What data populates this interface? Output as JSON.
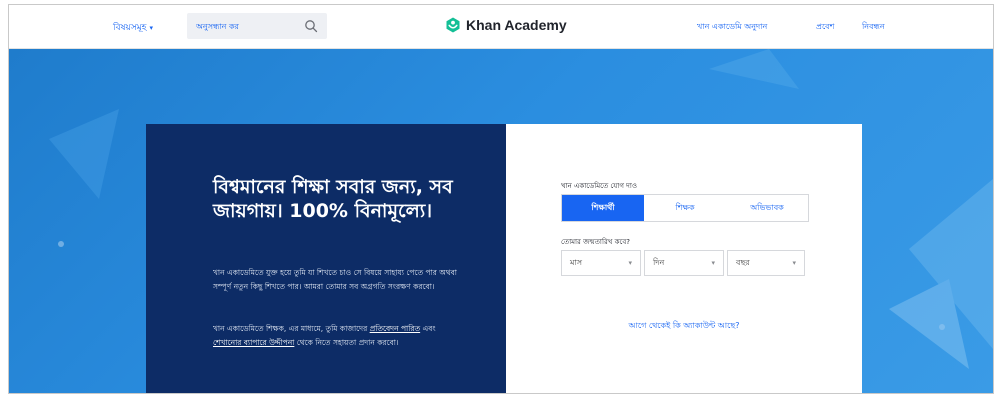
{
  "nav": {
    "subjects_label": "বিষয়সমূহ",
    "search_placeholder": "অনুসন্ধান কর",
    "brand_name": "Khan Academy",
    "donate_label": "খান একাডেমি অনুদান",
    "login_label": "প্রবেশ",
    "signup_label": "নিবন্ধন"
  },
  "hero": {
    "headline": "বিশ্বমানের শিক্ষা সবার জন্য, সব জায়গায়। 100% বিনামূল্যে।",
    "paragraph1": "খান একাডেমিতে যুক্ত হয়ে তুমি যা শিখতে চাও সে বিষয়ে সাহায্য পেতে পার অথবা সম্পূর্ণ নতুন কিছু শিখতে পার। আমরা তোমার সব অগ্রগতি সংরক্ষণ করবো।",
    "paragraph2_start": "খান একাডেমিতে শিক্ষক, এর মাধ্যমে, তুমি কাজাদের ",
    "paragraph2_link1": "প্রতিবেদন পারিত",
    "paragraph2_mid": " এবং ",
    "paragraph2_link2": "শেখানোর ব্যাপারে উদ্দীপনা",
    "paragraph2_end": " থেকে নিতে সহায়তা প্রদান করবো।"
  },
  "signup": {
    "join_label": "খান একাডেমিতে যোগ দাও",
    "roles": [
      "শিক্ষার্থী",
      "শিক্ষক",
      "অভিভাবক"
    ],
    "active_role": "শিক্ষার্থী",
    "dob_label": "তোমার জন্মতারিখ কবে?",
    "month_placeholder": "মাস",
    "day_placeholder": "দিন",
    "year_placeholder": "বছর",
    "account_link": "আগে থেকেই কি অ্যাকাউন্ট আছে?"
  },
  "colors": {
    "accent": "#1865f2",
    "hero_blue": "#2b8ee0",
    "card_navy": "#0d2c66",
    "brand_green": "#14bf96"
  },
  "icons": {
    "search": "search-icon",
    "logo": "khan-academy-logo-icon",
    "caret": "chevron-down-icon"
  }
}
